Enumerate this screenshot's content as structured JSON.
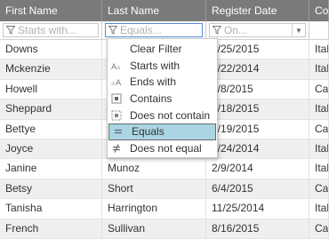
{
  "columns": [
    "First Name",
    "Last Name",
    "Register Date",
    "Co"
  ],
  "filters": {
    "first_name_placeholder": "Starts with...",
    "last_name_placeholder": "Equals...",
    "date_placeholder": "On..."
  },
  "rows": [
    [
      "Downs",
      "",
      "6/25/2015",
      "Ital"
    ],
    [
      "Mckenzie",
      "",
      "4/22/2014",
      "Ital"
    ],
    [
      "Howell",
      "",
      "2/8/2015",
      "Ca"
    ],
    [
      "Sheppard",
      "",
      "4/18/2015",
      "Ital"
    ],
    [
      "Bettye",
      "",
      "6/19/2015",
      "Ca"
    ],
    [
      "Joyce",
      "",
      "1/24/2014",
      "Ital"
    ],
    [
      "Janine",
      "Munoz",
      "2/9/2014",
      "Ital"
    ],
    [
      "Betsy",
      "Short",
      "6/4/2015",
      "Ca"
    ],
    [
      "Tanisha",
      "Harrington",
      "11/25/2014",
      "Ital"
    ],
    [
      "French",
      "Sullivan",
      "8/16/2015",
      "Ca"
    ]
  ],
  "menu": {
    "items": [
      {
        "label": "Clear Filter",
        "icon": "none"
      },
      {
        "label": "Starts with",
        "icon": "starts-with-icon"
      },
      {
        "label": "Ends with",
        "icon": "ends-with-icon"
      },
      {
        "label": "Contains",
        "icon": "contains-icon"
      },
      {
        "label": "Does not contain",
        "icon": "does-not-contain-icon"
      },
      {
        "label": "Equals",
        "icon": "equals-icon"
      },
      {
        "label": "Does not equal",
        "icon": "not-equal-icon"
      }
    ],
    "selected": "Equals",
    "selected_color": "#a9d6e2"
  },
  "colors": {
    "header_bg": "#7a7a7a",
    "alt_row": "#efefef"
  }
}
